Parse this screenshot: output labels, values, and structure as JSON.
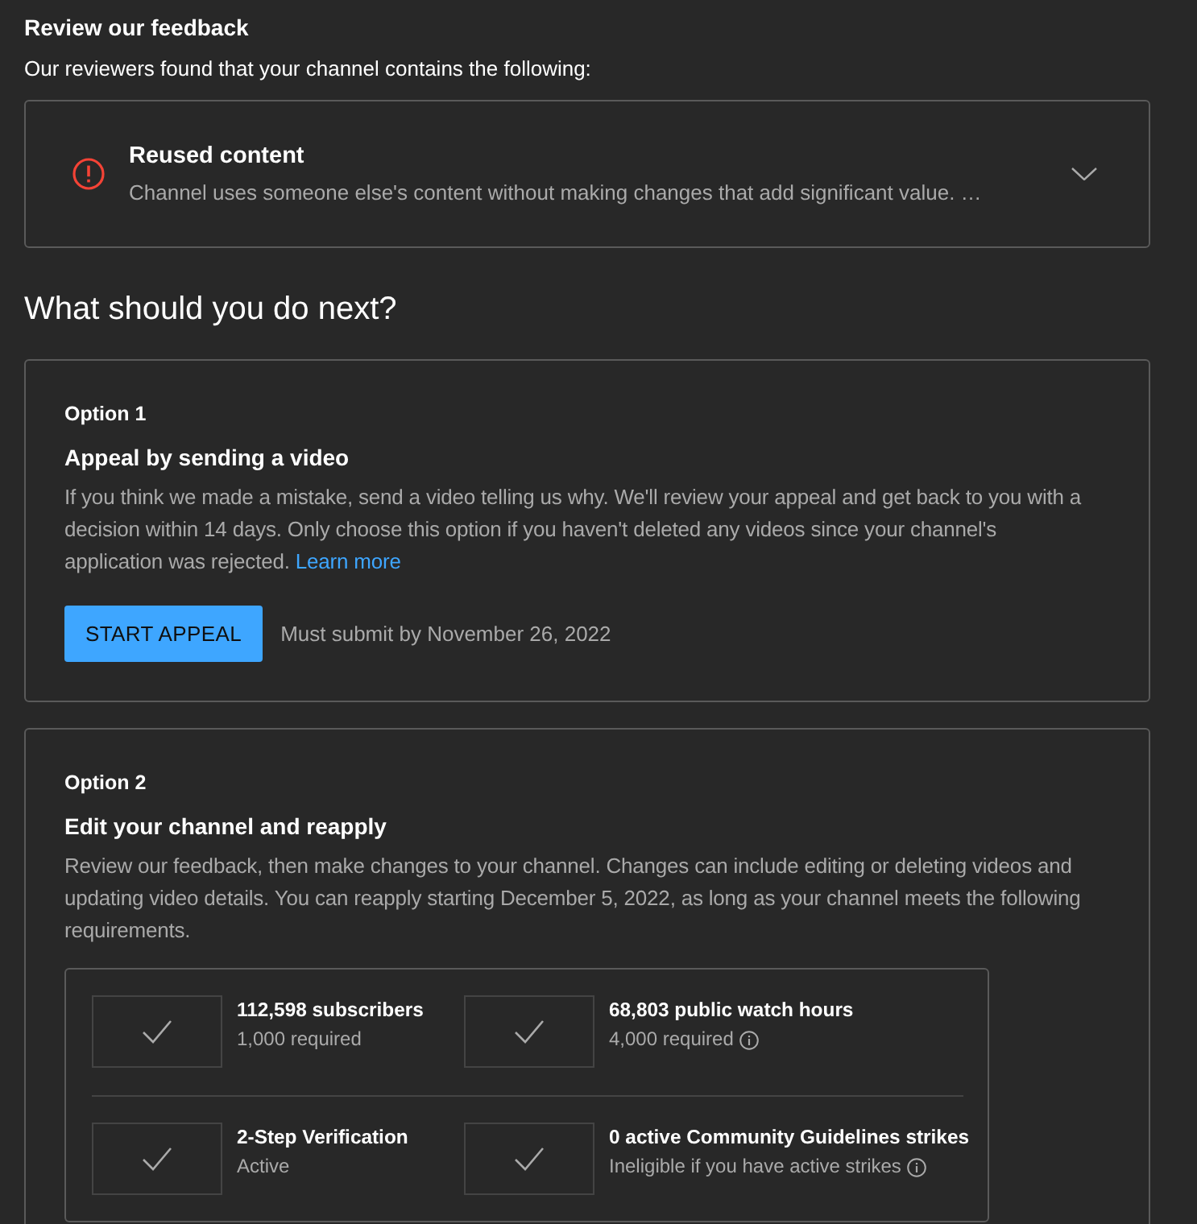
{
  "feedback": {
    "title": "Review our feedback",
    "subtitle": "Our reviewers found that your channel contains the following:",
    "issues": [
      {
        "title": "Reused content",
        "description": "Channel uses someone else's content without making changes that add significant value. …",
        "expanded": false
      }
    ]
  },
  "next_steps": {
    "heading": "What should you do next?",
    "options": [
      {
        "kind": "appeal",
        "label": "Option 1",
        "title": "Appeal by sending a video",
        "description": "If you think we made a mistake, send a video telling us why. We'll review your appeal and get back to you with a decision within 14 days. Only choose this option if you haven't deleted any videos since your channel's application was rejected.",
        "link": "Learn more",
        "button": "START APPEAL",
        "deadline": "Must submit by November 26, 2022"
      },
      {
        "kind": "reapply",
        "label": "Option 2",
        "title": "Edit your channel and reapply",
        "description": "Review our feedback, then make changes to your channel. Changes can include editing or deleting videos and updating video details. You can reapply starting December 5, 2022, as long as your channel meets the following requirements.",
        "requirements": [
          {
            "title": "112,598 subscribers",
            "detail": "1,000 required",
            "met": true,
            "info": false
          },
          {
            "title": "68,803 public watch hours",
            "detail": "4,000 required",
            "met": true,
            "info": true
          },
          {
            "title": "2-Step Verification",
            "detail": "Active",
            "met": true,
            "info": false
          },
          {
            "title": "0 active Community Guidelines strikes",
            "detail": "Ineligible if you have active strikes",
            "met": true,
            "info": true
          }
        ]
      }
    ]
  }
}
